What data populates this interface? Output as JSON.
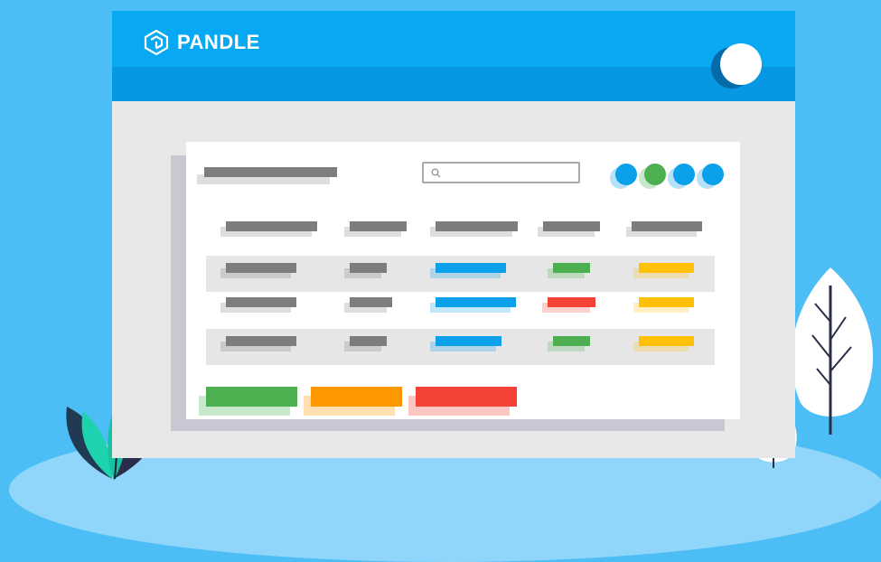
{
  "brand": {
    "name": "PANDLE"
  },
  "colors": {
    "background": "#4dbef5",
    "header": "#09a8f2",
    "gray": "#7d7d7d",
    "blue": "#0aa0ea",
    "green": "#4caf50",
    "red": "#f44336",
    "yellow": "#ffc107",
    "orange": "#ff9800"
  },
  "icons": {
    "logo": "pandle-logo-icon",
    "search": "search-icon",
    "avatar": "user-avatar-icon"
  },
  "status_dots": [
    "#0aa0ea",
    "#4caf50",
    "#0aa0ea",
    "#0aa0ea"
  ],
  "action_buttons": [
    "#4caf50",
    "#ff9800",
    "#f44336"
  ]
}
